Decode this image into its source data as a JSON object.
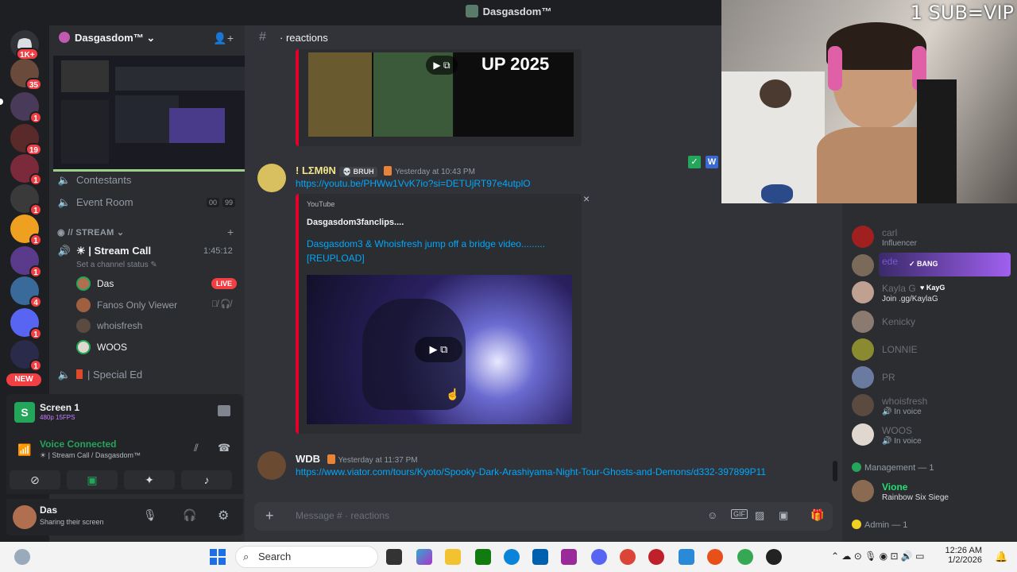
{
  "window": {
    "title": "Dasgasdom™"
  },
  "rail": {
    "top_badge": "1K+",
    "badges": [
      "35",
      "1",
      "19",
      "1",
      "1",
      "1",
      "1",
      "4",
      "1",
      "1"
    ],
    "new_label": "NEW"
  },
  "server": {
    "name": "Dasgasdom™"
  },
  "channels": {
    "contestants": "Contestants",
    "event_room": "Event Room",
    "event_room_counts": [
      "00",
      "99"
    ],
    "stream_category": "// STREAM",
    "stream_call": "Stream Call",
    "stream_call_time": "1:45:12",
    "channel_status_placeholder": "Set a channel status",
    "special_ed": "Special Ed",
    "voice_users": [
      {
        "name": "Das",
        "live": "LIVE"
      },
      {
        "name": "Fanos Only Viewer"
      },
      {
        "name": "whoisfresh"
      },
      {
        "name": "WOOS"
      }
    ]
  },
  "screen_panel": {
    "title": "Screen 1",
    "quality": "480p 15FPS"
  },
  "voice_panel": {
    "status": "Voice Connected",
    "location": "Stream Call / Dasgasdom™"
  },
  "user_panel": {
    "name": "Das",
    "status": "Sharing their screen"
  },
  "chat": {
    "channel": "reactions",
    "poster_text": "UP 2025",
    "messages": [
      {
        "author": "! LΣMθN",
        "tag": "BRUH",
        "timestamp": "Yesterday at 10:43 PM",
        "link": "https://youtu.be/PHWw1VvK7io?si=DETUjRT97e4utplO",
        "embed": {
          "provider": "YouTube",
          "author": "Dasgasdom3fanclips....",
          "title": "Dasgasdom3 & Whoisfresh jump off a bridge video......... [REUPLOAD]"
        }
      },
      {
        "author": "WDB",
        "timestamp": "Yesterday at 11:37 PM",
        "link": "https://www.viator.com/tours/Kyoto/Spooky-Dark-Arashiyama-Night-Tour-Ghosts-and-Demons/d332-397899P11"
      }
    ],
    "composer_placeholder": "Message #  ·  reactions"
  },
  "members": {
    "list": [
      {
        "name": "carl",
        "sub": "Influencer"
      },
      {
        "name": "ede",
        "tag": "BANG"
      },
      {
        "name": "Kayla G",
        "tag": "KayG",
        "sub": "Join .gg/KaylaG"
      },
      {
        "name": "Kenicky"
      },
      {
        "name": "LONNIE"
      },
      {
        "name": "PR"
      },
      {
        "name": "whoisfresh",
        "sub": "In voice"
      },
      {
        "name": "WOOS",
        "sub": "In voice"
      }
    ],
    "management_header": "Management — 1",
    "management_member": {
      "name": "Vione",
      "sub": "Rainbow Six Siege"
    },
    "admin_header": "Admin — 1"
  },
  "webcam": {
    "overlay_text": "1 SUB=VIP"
  },
  "taskbar": {
    "search_label": "Search",
    "time": "12:26 AM",
    "date": "1/2/2026"
  },
  "colors": {
    "discord_bg": "#313338",
    "sidebar_bg": "#2b2d31",
    "link": "#00a8fc",
    "live_red": "#f23f43",
    "voice_green": "#23a55a"
  }
}
